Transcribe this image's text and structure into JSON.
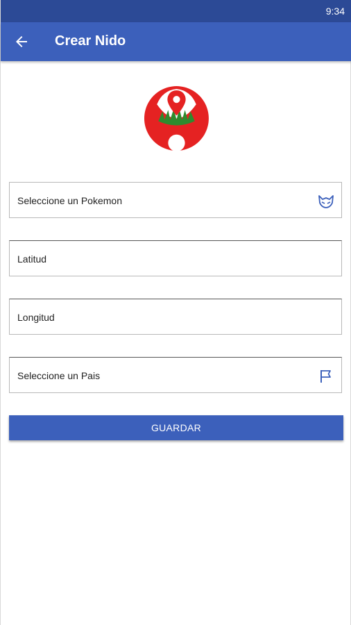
{
  "status_bar": {
    "time": "9:34"
  },
  "app_bar": {
    "title": "Crear Nido",
    "back_icon": "arrow-left-icon"
  },
  "logo": {
    "name": "nest-location-logo",
    "colors": {
      "red": "#e52222",
      "grass": "#2e8b2e",
      "white": "#ffffff"
    }
  },
  "form": {
    "pokemon": {
      "label": "Seleccione un Pokemon",
      "icon": "pokemon-mask-icon"
    },
    "latitude": {
      "value": "Latitud"
    },
    "longitude": {
      "value": "Longitud"
    },
    "country": {
      "label": "Seleccione un Pais",
      "icon": "flag-icon"
    },
    "save_label": "GUARDAR"
  },
  "colors": {
    "primary": "#3c60bb",
    "primary_dark": "#2c4a96"
  }
}
